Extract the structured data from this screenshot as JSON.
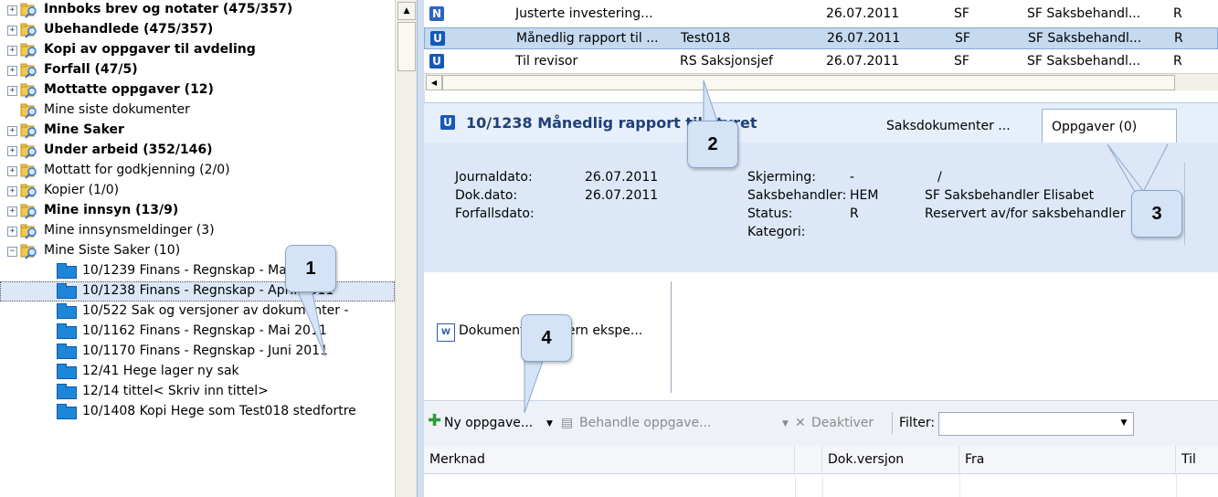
{
  "tree": {
    "roots": [
      {
        "label": "Innboks brev og notater (475/357)",
        "bold": true
      },
      {
        "label": "Ubehandlede (475/357)",
        "bold": true
      },
      {
        "label": "Kopi av oppgaver til avdeling",
        "bold": true
      },
      {
        "label": "Forfall (47/5)",
        "bold": true
      },
      {
        "label": "Mottatte oppgaver (12)",
        "bold": true
      },
      {
        "label": "Mine siste dokumenter",
        "bold": false,
        "noexpander": true
      },
      {
        "label": "Mine Saker",
        "bold": true
      },
      {
        "label": "Under arbeid (352/146)",
        "bold": true
      },
      {
        "label": "Mottatt for godkjenning (2/0)",
        "bold": false
      },
      {
        "label": "Kopier (1/0)",
        "bold": false
      },
      {
        "label": "Mine innsyn (13/9)",
        "bold": true
      },
      {
        "label": "Mine innsynsmeldinger (3)",
        "bold": false
      },
      {
        "label": "Mine Siste Saker (10)",
        "bold": false,
        "expanded": true
      }
    ],
    "children": [
      {
        "label": "10/1239 Finans - Regnskap - Mars 2011"
      },
      {
        "label": "10/1238 Finans - Regnskap - April 2011",
        "selected": true
      },
      {
        "label": "10/522 Sak og versjoner av dokumenter -"
      },
      {
        "label": "10/1162 Finans - Regnskap - Mai 2011"
      },
      {
        "label": "10/1170 Finans - Regnskap - Juni 2011"
      },
      {
        "label": "12/41 Hege lager ny sak"
      },
      {
        "label": "12/14 tittel< Skriv inn tittel>"
      },
      {
        "label": "10/1408 Kopi Hege som Test018 stedfortre"
      }
    ]
  },
  "doclist": {
    "rows": [
      {
        "badge": "N",
        "title": "Justerte investering...",
        "from": "",
        "date": "26.07.2011",
        "unit": "SF",
        "handler": "SF Saksbehandl...",
        "status": "R"
      },
      {
        "badge": "U",
        "title": "Månedlig rapport til ...",
        "from": "Test018",
        "date": "26.07.2011",
        "unit": "SF",
        "handler": "SF Saksbehandl...",
        "status": "R",
        "selected": true
      },
      {
        "badge": "U",
        "title": "Til revisor",
        "from": "RS Saksjonsjef",
        "date": "26.07.2011",
        "unit": "SF",
        "handler": "SF Saksbehandl...",
        "status": "R"
      }
    ]
  },
  "document": {
    "badge": "U",
    "title": "10/1238  Månedlig rapport til styret",
    "tabs": [
      "Saksdokumenter ...",
      "Oppgaver (0)"
    ],
    "fields": {
      "journaldato_label": "Journaldato:",
      "journaldato": "26.07.2011",
      "dokdato_label": "Dok.dato:",
      "dokdato": "26.07.2011",
      "forfallsdato_label": "Forfallsdato:",
      "skjerming_label": "Skjerming:",
      "skjerming": "-",
      "skjerming_extra": "/",
      "saksbehandler_label": "Saksbehandler:",
      "saksbehandler_code": "HEM",
      "saksbehandler_name": "SF Saksbehandler Elisabet",
      "status_label": "Status:",
      "status_code": "R",
      "status_text": "Reservert av/for saksbehandler",
      "kategori_label": "Kategori:"
    }
  },
  "attachment": {
    "label": "Dokument for intern ekspe..."
  },
  "toolbar": {
    "new_task": "Ny oppgave...",
    "handle_task": "Behandle oppgave...",
    "deactivate": "Deaktiver",
    "filter_label": "Filter:"
  },
  "grid": {
    "columns": [
      "Merknad",
      "",
      "Dok.versjon",
      "Fra",
      "Til"
    ]
  },
  "callouts": [
    "1",
    "2",
    "3",
    "4"
  ],
  "colors": {
    "accent_blue": "#1f3f77",
    "badge_n": "#2a62c6",
    "badge_u": "#1559b8",
    "selection": "#c5d9ef"
  }
}
